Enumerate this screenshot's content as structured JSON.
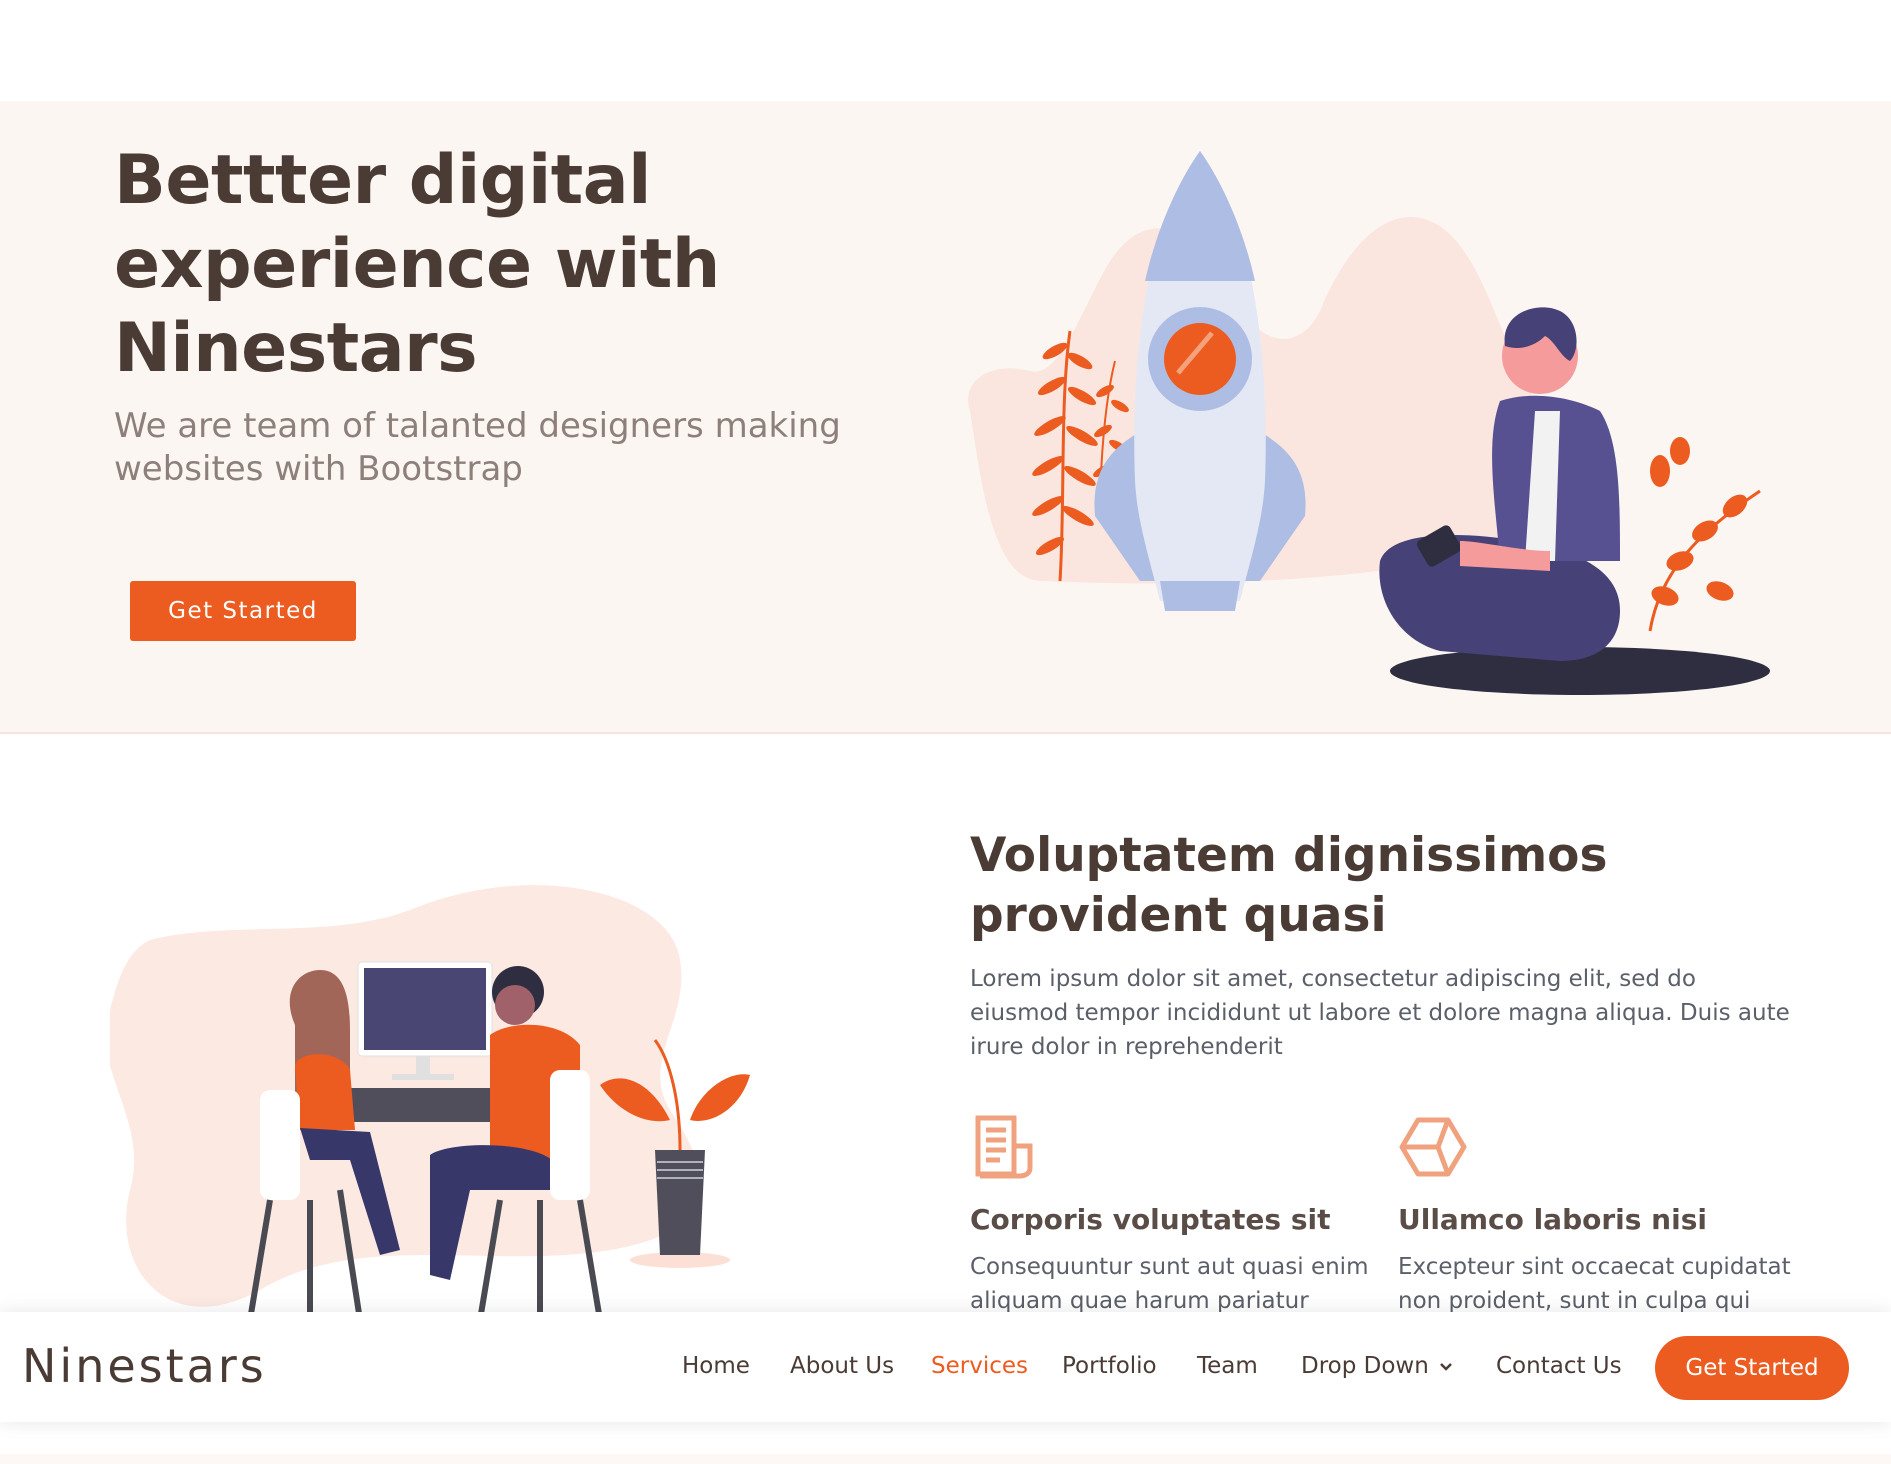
{
  "hero": {
    "title": "Bettter digital experience with Ninestars",
    "subtitle": "We are team of talanted designers making websites with Bootstrap",
    "cta_label": "Get Started"
  },
  "about": {
    "title": "Voluptatem dignissimos provident quasi",
    "text": "Lorem ipsum dolor sit amet, consectetur adipiscing elit, sed do eiusmod tempor incididunt ut labore et dolore magna aliqua. Duis aute irure dolor in reprehenderit",
    "features": [
      {
        "icon": "receipt-icon",
        "title": "Corporis voluptates sit",
        "text": "Consequuntur sunt aut quasi enim aliquam quae harum pariatur"
      },
      {
        "icon": "cube-icon",
        "title": "Ullamco laboris nisi",
        "text": "Excepteur sint occaecat cupidatat non proident, sunt in culpa qui"
      }
    ]
  },
  "navbar": {
    "brand": "Ninestars",
    "items": [
      {
        "label": "Home",
        "active": false
      },
      {
        "label": "About Us",
        "active": false
      },
      {
        "label": "Services",
        "active": true
      },
      {
        "label": "Portfolio",
        "active": false
      },
      {
        "label": "Team",
        "active": false
      },
      {
        "label": "Drop Down",
        "active": false,
        "icon": "chevron-down-icon"
      },
      {
        "label": "Contact Us",
        "active": false
      }
    ],
    "cta_label": "Get Started"
  },
  "colors": {
    "accent": "#ec5b1f",
    "heading": "#4a3b35",
    "hero_bg": "#fcf6f3",
    "body_text": "#5b5f69"
  }
}
